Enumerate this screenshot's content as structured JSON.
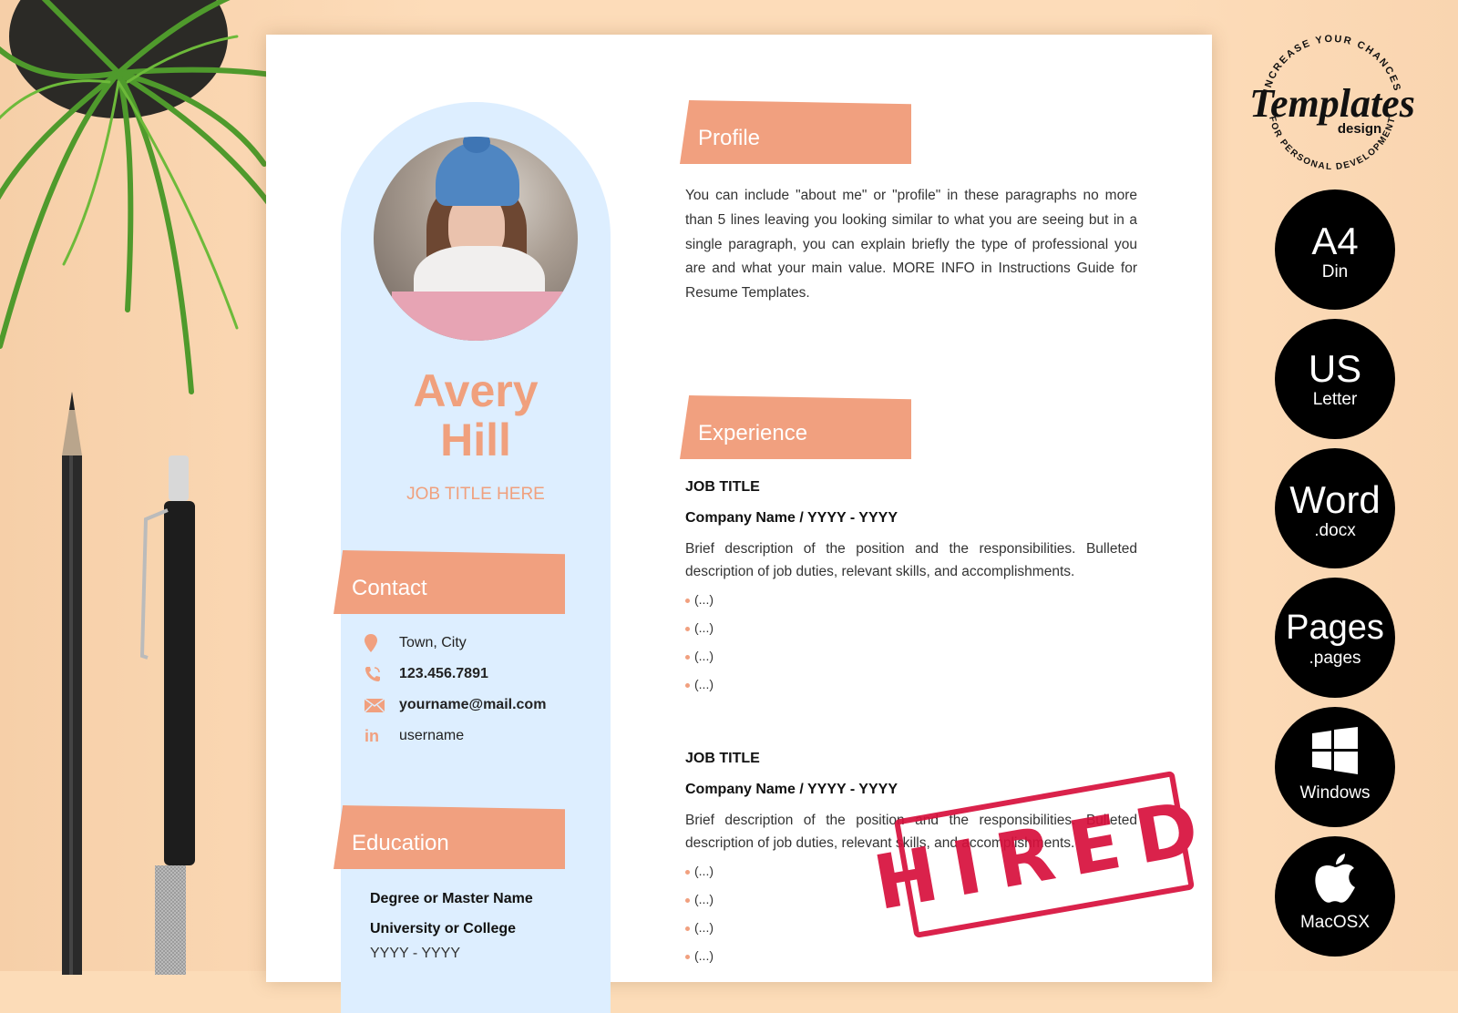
{
  "resume": {
    "first_name": "Avery",
    "last_name": "Hill",
    "job_title": "JOB TITLE HERE",
    "sections": {
      "profile": "Profile",
      "experience": "Experience",
      "contact": "Contact",
      "education": "Education"
    },
    "profile_text": "You can include \"about me\" or \"profile\" in these paragraphs no more than 5 lines leaving you looking similar to what you are seeing but in a single paragraph, you can explain briefly the type of professional you are and what your main value. MORE INFO in Instructions Guide for Resume Templates.",
    "contact": [
      {
        "icon": "location-pin-icon",
        "value": "Town, City"
      },
      {
        "icon": "phone-icon",
        "value": "123.456.7891"
      },
      {
        "icon": "envelope-icon",
        "value": "yourname@mail.com"
      },
      {
        "icon": "linkedin-icon",
        "value": "username"
      }
    ],
    "education": {
      "degree": "Degree or Master Name",
      "school": "University or College",
      "years": "YYYY - YYYY"
    },
    "experience": [
      {
        "job_title": "JOB TITLE",
        "company": "Company Name / YYYY - YYYY",
        "description": "Brief description of the position and the responsibilities. Bulleted description of job duties, relevant skills, and accomplishments.",
        "bullets": [
          "(...)",
          "(...)",
          "(...)",
          "(...)"
        ]
      },
      {
        "job_title": "JOB TITLE",
        "company": "Company Name / YYYY - YYYY",
        "description": "Brief description of the position and the responsibilities. Bulleted description of job duties, relevant skills, and accomplishments.",
        "bullets": [
          "(...)",
          "(...)",
          "(...)",
          "(...)"
        ]
      }
    ],
    "stamp": "HIRED"
  },
  "brand": {
    "logo_top": "INCREASE YOUR CHANCES",
    "logo_main": "Templates",
    "logo_sub": "design",
    "logo_bottom": "FOR PERSONAL DEVELOPMENT"
  },
  "badges": [
    {
      "big": "A4",
      "small": "Din"
    },
    {
      "big": "US",
      "small": "Letter"
    },
    {
      "big": "Word",
      "small": ".docx"
    },
    {
      "big": "Pages",
      "small": ".pages"
    },
    {
      "icon": "windows-logo-icon",
      "small": "Windows"
    },
    {
      "icon": "apple-logo-icon",
      "small": "MacOSX"
    }
  ],
  "colors": {
    "accent": "#f1a07f",
    "sidebar": "#ddeeff",
    "background": "#fddcb9",
    "stamp": "#d7103c"
  }
}
